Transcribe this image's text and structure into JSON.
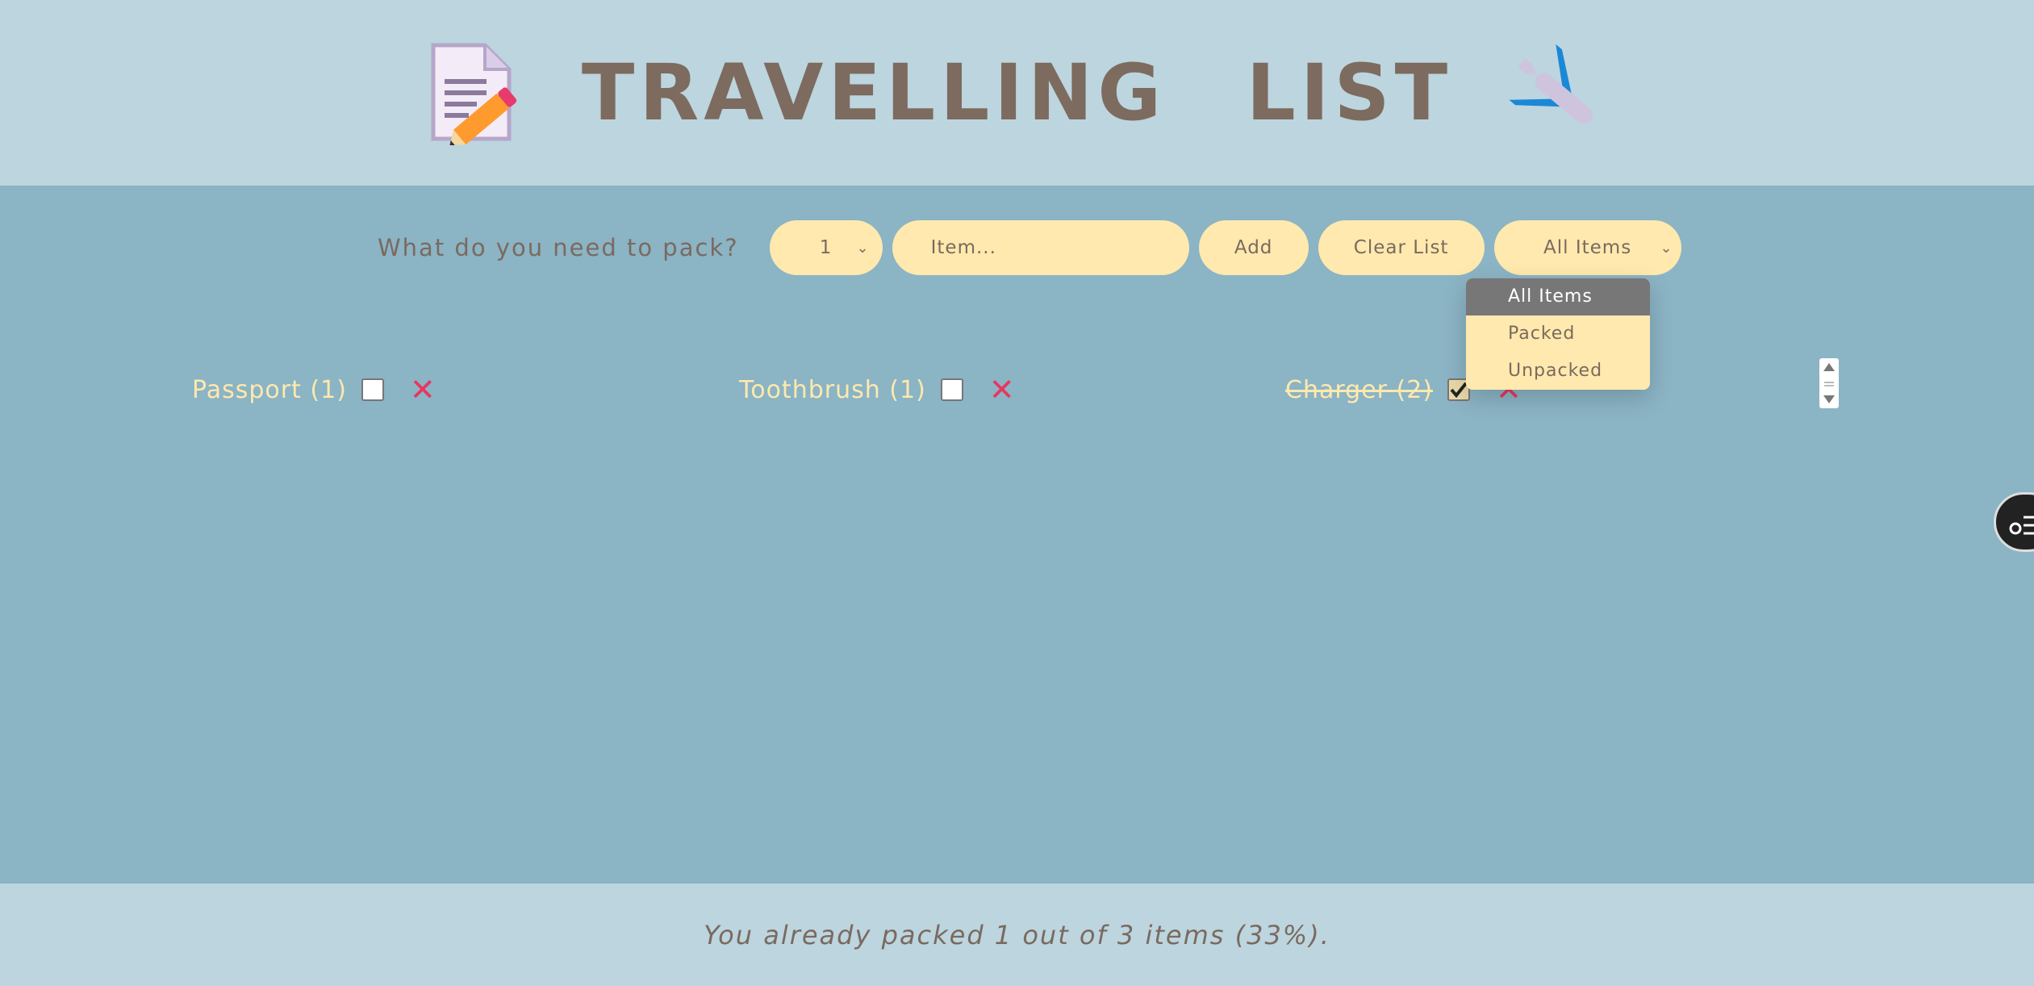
{
  "header": {
    "title": "TRAVELLING LIST",
    "left_icon": "memo-pencil-icon",
    "right_icon": "airplane-icon"
  },
  "form": {
    "prompt": "What do you need to pack?",
    "quantity_value": "1",
    "item_placeholder": "Item...",
    "add_label": "Add",
    "clear_label": "Clear List",
    "filter_value": "All Items"
  },
  "filter_dropdown": {
    "options": [
      "All Items",
      "Packed",
      "Unpacked"
    ],
    "selected": "All Items"
  },
  "items": [
    {
      "label": "Passport (1)",
      "packed": false
    },
    {
      "label": "Toothbrush (1)",
      "packed": false
    },
    {
      "label": "Charger (2)",
      "packed": true
    }
  ],
  "footer": {
    "stats": "You already packed 1 out of 3 items (33%)."
  },
  "colors": {
    "header_bg": "#bcd5df",
    "main_bg": "#8bb4c5",
    "pill_bg": "#ffe9ae",
    "text": "#7a6a5f",
    "delete": "#e8365f"
  }
}
